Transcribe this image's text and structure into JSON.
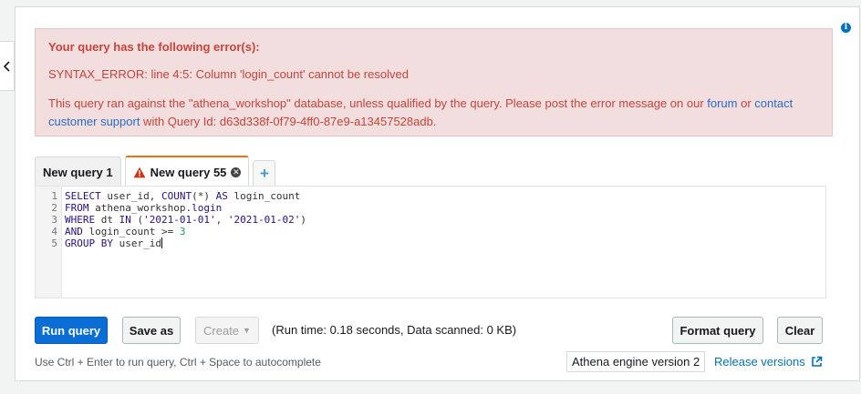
{
  "error": {
    "title": "Your query has the following error(s):",
    "message": "SYNTAX_ERROR: line 4:5: Column 'login_count' cannot be resolved",
    "note_prefix": "This query ran against the \"athena_workshop\" database, unless qualified by the query. Please post the error message on our ",
    "forum_link": "forum",
    "or_text": " or ",
    "contact_link": "contact",
    "support_link": "customer support",
    "note_suffix": " with Query Id: d63d338f-0f79-4ff0-87e9-a13457528adb."
  },
  "tabs": [
    {
      "label": "New query 1",
      "active": false
    },
    {
      "label": "New query 55",
      "active": true,
      "has_error": true
    }
  ],
  "add_tab_label": "+",
  "editor": {
    "line_numbers": [
      "1",
      "2",
      "3",
      "4",
      "5"
    ],
    "tokens": {
      "l1_select": "SELECT",
      "l1_a": " user_id, ",
      "l1_count": "COUNT",
      "l1_b": "(*) ",
      "l1_as": "AS",
      "l1_c": " login_count",
      "l2_from": "FROM",
      "l2_a": " athena_workshop.",
      "l2_login": "login",
      "l3_where": "WHERE",
      "l3_a": " dt ",
      "l3_in": "IN",
      "l3_b": " (",
      "l3_s1": "'2021-01-01'",
      "l3_c": ", ",
      "l3_s2": "'2021-01-02'",
      "l3_d": ")",
      "l4_and": "AND",
      "l4_a": " login_count >= ",
      "l4_num": "3",
      "l5_group": "GROUP BY",
      "l5_a": " user_id"
    }
  },
  "buttons": {
    "run": "Run query",
    "save_as": "Save as",
    "create": "Create",
    "format": "Format query",
    "clear": "Clear"
  },
  "run_stats": "(Run time: 0.18 seconds, Data scanned: 0 KB)",
  "hint": "Use Ctrl + Enter to run query, Ctrl + Space to autocomplete",
  "engine_version": "Athena engine version 2",
  "release_link": "Release versions",
  "colors": {
    "error_bg": "#f2dede",
    "error_text": "#c7443a",
    "primary_button": "#0b6ed6",
    "active_tab_accent": "#ec7211",
    "link": "#0073bb"
  }
}
